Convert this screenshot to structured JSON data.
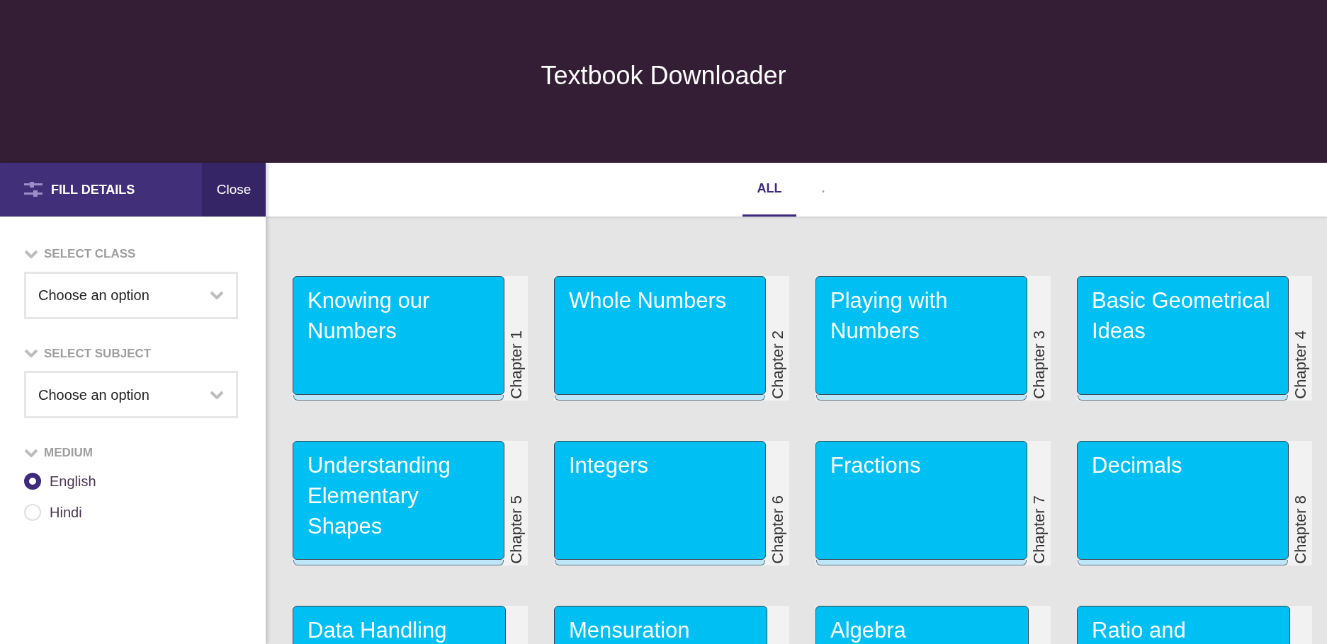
{
  "header": {
    "title": "Textbook Downloader"
  },
  "sidebar": {
    "title": "FILL DETAILS",
    "close_button": "Close",
    "sections": [
      {
        "kind": "select",
        "label": "SELECT CLASS",
        "placeholder": "Choose an option"
      },
      {
        "kind": "select",
        "label": "SELECT SUBJECT",
        "placeholder": "Choose an option"
      },
      {
        "kind": "radio",
        "label": "MEDIUM",
        "options": [
          {
            "label": "English",
            "selected": true
          },
          {
            "label": "Hindi",
            "selected": false
          }
        ]
      }
    ]
  },
  "tabs": [
    {
      "label": "ALL",
      "selected": true
    },
    {
      "label": ".",
      "selected": false
    }
  ],
  "chapters": [
    {
      "title": "Knowing our Numbers",
      "chapter": "Chapter 1"
    },
    {
      "title": "Whole Numbers",
      "chapter": "Chapter 2"
    },
    {
      "title": "Playing with Numbers",
      "chapter": "Chapter 3"
    },
    {
      "title": "Basic Geometrical Ideas",
      "chapter": "Chapter 4"
    },
    {
      "title": "Understanding Elementary Shapes",
      "chapter": "Chapter 5"
    },
    {
      "title": "Integers",
      "chapter": "Chapter 6"
    },
    {
      "title": "Fractions",
      "chapter": "Chapter 7"
    },
    {
      "title": "Decimals",
      "chapter": "Chapter 8"
    },
    {
      "title": "Data Handling"
    },
    {
      "title": "Mensuration"
    },
    {
      "title": "Algebra"
    },
    {
      "title": "Ratio and"
    }
  ]
}
